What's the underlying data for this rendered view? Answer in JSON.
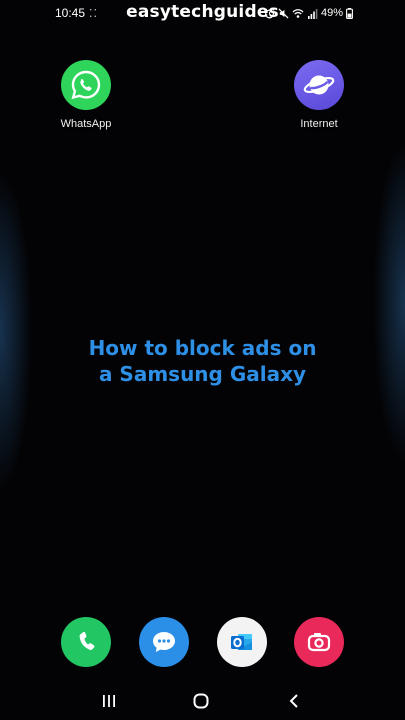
{
  "status_bar": {
    "time": "10:45",
    "notification_dots": "⁚⁚",
    "battery_percent": "49%"
  },
  "watermark": "easytechguides",
  "home_apps": [
    {
      "label": "WhatsApp",
      "icon": "whatsapp-icon",
      "color": "#2fd45b"
    },
    {
      "label": "Internet",
      "icon": "samsung-internet-icon",
      "color": "#6a5ae6"
    }
  ],
  "headline": {
    "line1": "How to block ads on",
    "line2": "a Samsung Galaxy",
    "color": "#2e8fe6"
  },
  "dock": [
    {
      "icon": "phone-icon",
      "color": "#22c764"
    },
    {
      "icon": "messages-icon",
      "color": "#2b8fe8"
    },
    {
      "icon": "outlook-icon",
      "color": "#0a6ed1"
    },
    {
      "icon": "camera-icon",
      "color": "#e8295a"
    }
  ],
  "nav_bar": {
    "buttons": [
      "recents",
      "home",
      "back"
    ]
  }
}
